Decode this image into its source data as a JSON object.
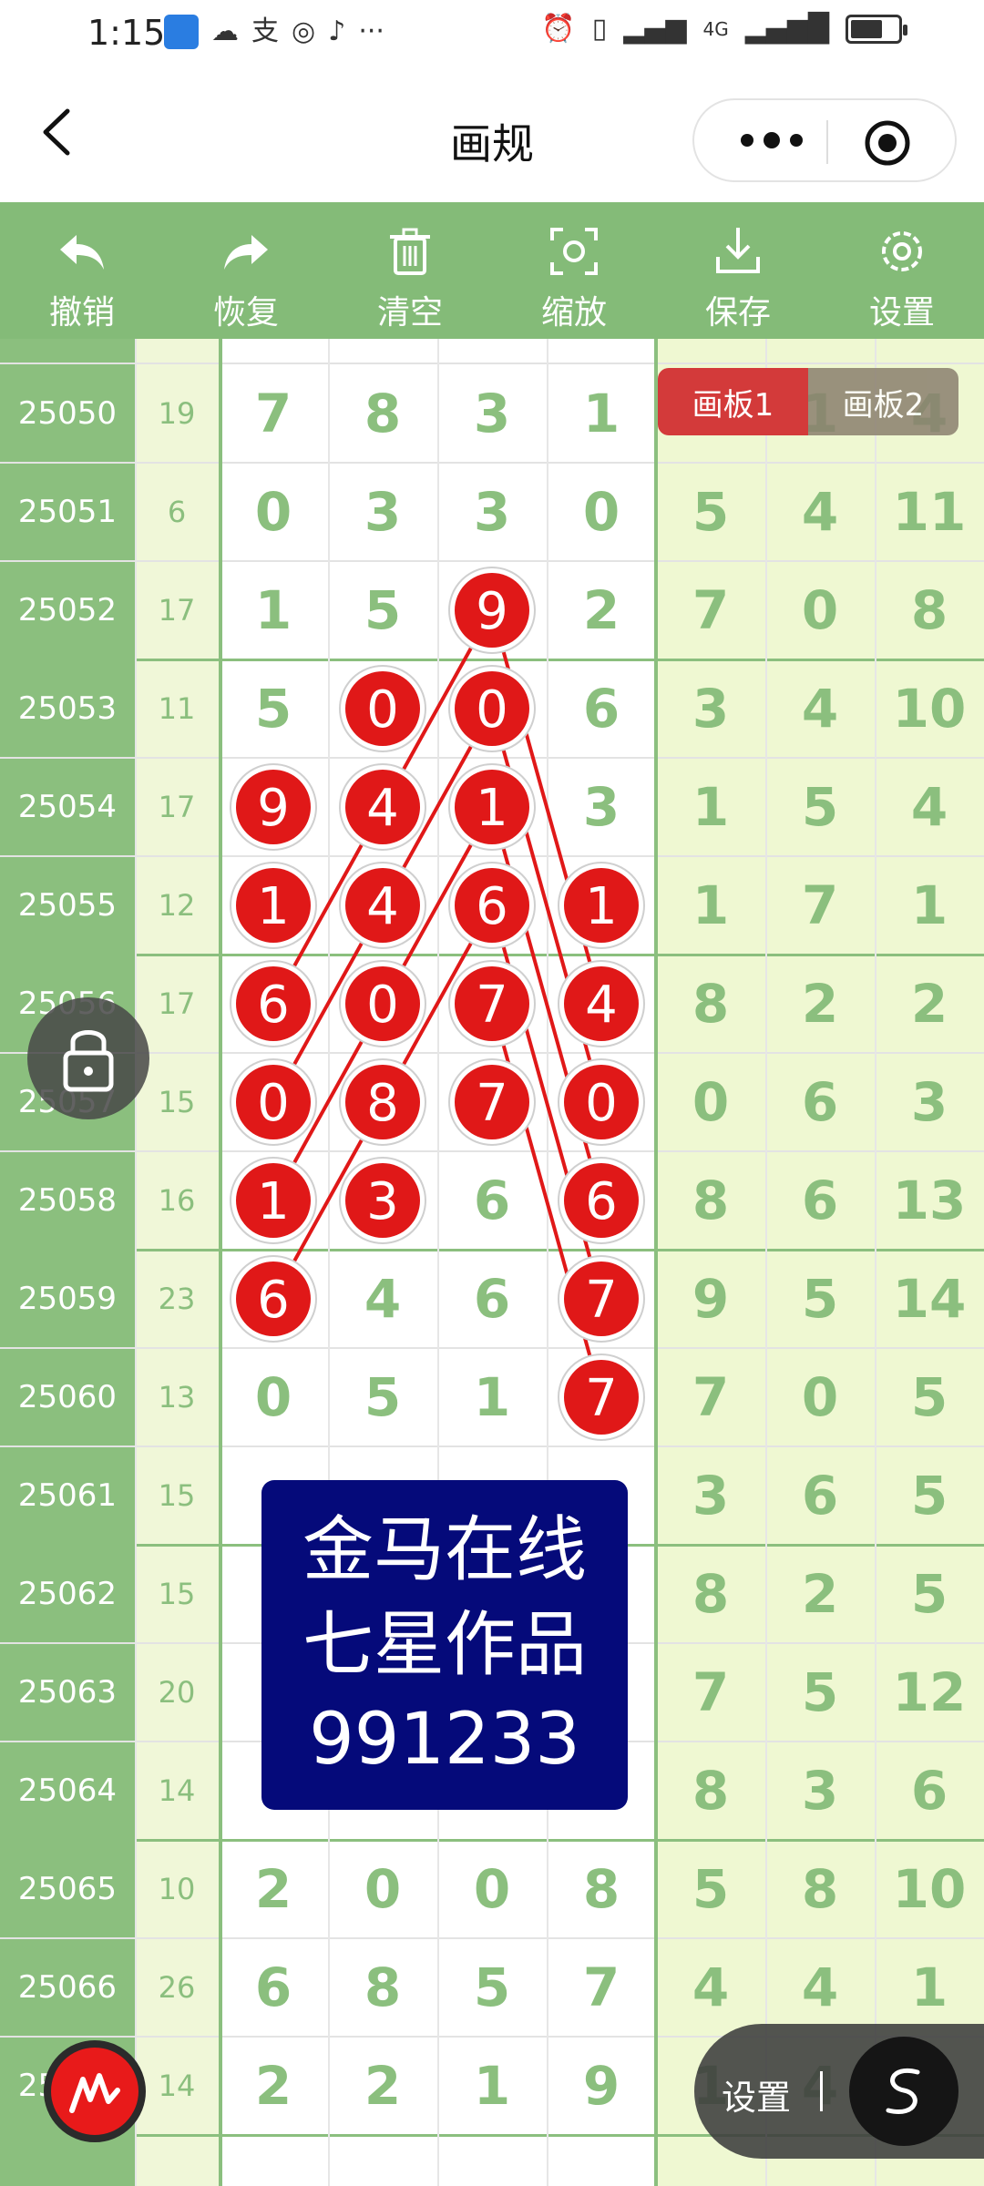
{
  "status_bar": {
    "time": "1:15",
    "more": "···",
    "network": "4G"
  },
  "header": {
    "title": "画规",
    "back_icon": "chevron-left-icon",
    "more_icon": "ellipsis-icon",
    "target_icon": "target-icon"
  },
  "toolbar": {
    "items": [
      {
        "label": "撤销",
        "icon": "undo-icon"
      },
      {
        "label": "恢复",
        "icon": "redo-icon"
      },
      {
        "label": "清空",
        "icon": "trash-icon"
      },
      {
        "label": "缩放",
        "icon": "zoom-icon"
      },
      {
        "label": "保存",
        "icon": "download-icon"
      },
      {
        "label": "设置",
        "icon": "gear-icon"
      }
    ]
  },
  "board_tabs": {
    "tab1": "画板1",
    "tab2": "画板2",
    "active": "画板1"
  },
  "rows": [
    {
      "issue": "25050",
      "sum": "19",
      "main": [
        "7",
        "8",
        "3",
        "1"
      ],
      "right": [
        "",
        "1",
        "4"
      ]
    },
    {
      "issue": "25051",
      "sum": "6",
      "main": [
        "0",
        "3",
        "3",
        "0"
      ],
      "right": [
        "5",
        "4",
        "11"
      ]
    },
    {
      "issue": "25052",
      "sum": "17",
      "main": [
        "1",
        "5",
        "9",
        "2"
      ],
      "right": [
        "7",
        "0",
        "8"
      ]
    },
    {
      "issue": "25053",
      "sum": "11",
      "main": [
        "5",
        "0",
        "0",
        "6"
      ],
      "right": [
        "3",
        "4",
        "10"
      ]
    },
    {
      "issue": "25054",
      "sum": "17",
      "main": [
        "9",
        "4",
        "1",
        "3"
      ],
      "right": [
        "1",
        "5",
        "4"
      ]
    },
    {
      "issue": "25055",
      "sum": "12",
      "main": [
        "1",
        "4",
        "6",
        "1"
      ],
      "right": [
        "1",
        "7",
        "1"
      ]
    },
    {
      "issue": "25056",
      "sum": "17",
      "main": [
        "6",
        "0",
        "7",
        "4"
      ],
      "right": [
        "8",
        "2",
        "2"
      ]
    },
    {
      "issue": "25057",
      "sum": "15",
      "main": [
        "0",
        "8",
        "7",
        "0"
      ],
      "right": [
        "0",
        "6",
        "3"
      ]
    },
    {
      "issue": "25058",
      "sum": "16",
      "main": [
        "1",
        "3",
        "6",
        "6"
      ],
      "right": [
        "8",
        "6",
        "13"
      ]
    },
    {
      "issue": "25059",
      "sum": "23",
      "main": [
        "6",
        "4",
        "6",
        "7"
      ],
      "right": [
        "9",
        "5",
        "14"
      ]
    },
    {
      "issue": "25060",
      "sum": "13",
      "main": [
        "0",
        "5",
        "1",
        "7"
      ],
      "right": [
        "7",
        "0",
        "5"
      ]
    },
    {
      "issue": "25061",
      "sum": "15",
      "main": [
        "",
        "",
        "",
        ""
      ],
      "right": [
        "3",
        "6",
        "5"
      ]
    },
    {
      "issue": "25062",
      "sum": "15",
      "main": [
        "",
        "",
        "",
        ""
      ],
      "right": [
        "8",
        "2",
        "5"
      ]
    },
    {
      "issue": "25063",
      "sum": "20",
      "main": [
        "",
        "",
        "",
        ""
      ],
      "right": [
        "7",
        "5",
        "12"
      ]
    },
    {
      "issue": "25064",
      "sum": "14",
      "main": [
        "",
        "",
        "",
        ""
      ],
      "right": [
        "8",
        "3",
        "6"
      ]
    },
    {
      "issue": "25065",
      "sum": "10",
      "main": [
        "2",
        "0",
        "0",
        "8"
      ],
      "right": [
        "5",
        "8",
        "10"
      ]
    },
    {
      "issue": "25066",
      "sum": "26",
      "main": [
        "6",
        "8",
        "5",
        "7"
      ],
      "right": [
        "4",
        "4",
        "1"
      ]
    },
    {
      "issue": "25067",
      "sum": "14",
      "main": [
        "2",
        "2",
        "1",
        "9"
      ],
      "right": [
        "1",
        "4",
        "2"
      ]
    }
  ],
  "marks": [
    {
      "issue": "25052",
      "col": 3,
      "label": "9"
    },
    {
      "issue": "25053",
      "col": 2,
      "label": "0"
    },
    {
      "issue": "25053",
      "col": 3,
      "label": "0"
    },
    {
      "issue": "25054",
      "col": 1,
      "label": "9"
    },
    {
      "issue": "25054",
      "col": 2,
      "label": "4"
    },
    {
      "issue": "25054",
      "col": 3,
      "label": "1"
    },
    {
      "issue": "25055",
      "col": 1,
      "label": "1"
    },
    {
      "issue": "25055",
      "col": 2,
      "label": "4"
    },
    {
      "issue": "25055",
      "col": 3,
      "label": "6"
    },
    {
      "issue": "25055",
      "col": 4,
      "label": "1"
    },
    {
      "issue": "25056",
      "col": 1,
      "label": "6"
    },
    {
      "issue": "25056",
      "col": 2,
      "label": "0"
    },
    {
      "issue": "25056",
      "col": 3,
      "label": "7"
    },
    {
      "issue": "25056",
      "col": 4,
      "label": "4"
    },
    {
      "issue": "25057",
      "col": 1,
      "label": "0"
    },
    {
      "issue": "25057",
      "col": 2,
      "label": "8"
    },
    {
      "issue": "25057",
      "col": 3,
      "label": "7"
    },
    {
      "issue": "25057",
      "col": 4,
      "label": "0"
    },
    {
      "issue": "25058",
      "col": 1,
      "label": "1"
    },
    {
      "issue": "25058",
      "col": 2,
      "label": "3"
    },
    {
      "issue": "25058",
      "col": 4,
      "label": "6"
    },
    {
      "issue": "25059",
      "col": 1,
      "label": "6"
    },
    {
      "issue": "25059",
      "col": 4,
      "label": "7"
    },
    {
      "issue": "25060",
      "col": 4,
      "label": "7"
    }
  ],
  "lines": [
    {
      "from": [
        6,
        1
      ],
      "to": [
        2,
        3
      ]
    },
    {
      "from": [
        7,
        1
      ],
      "to": [
        3,
        3
      ]
    },
    {
      "from": [
        8,
        1
      ],
      "to": [
        4,
        3
      ]
    },
    {
      "from": [
        9,
        1
      ],
      "to": [
        5,
        3
      ]
    },
    {
      "from": [
        2,
        3
      ],
      "to": [
        6,
        4
      ]
    },
    {
      "from": [
        3,
        3
      ],
      "to": [
        7,
        4
      ]
    },
    {
      "from": [
        4,
        3
      ],
      "to": [
        8,
        4
      ]
    },
    {
      "from": [
        5,
        3
      ],
      "to": [
        9,
        4
      ]
    },
    {
      "from": [
        6,
        3
      ],
      "to": [
        10,
        4
      ]
    }
  ],
  "promo": {
    "line1": "金马在线",
    "line2": "七星作品",
    "line3": "991233"
  },
  "floating": {
    "lock_icon": "lock-icon",
    "pen_icon": "pen-icon",
    "settings_label": "设置",
    "s_icon": "s-curve-icon"
  },
  "colors": {
    "toolbar_green": "#84bb78",
    "issue_green": "#8bbf7e",
    "mark_red": "#e01818",
    "promo_blue": "#050a7a"
  }
}
